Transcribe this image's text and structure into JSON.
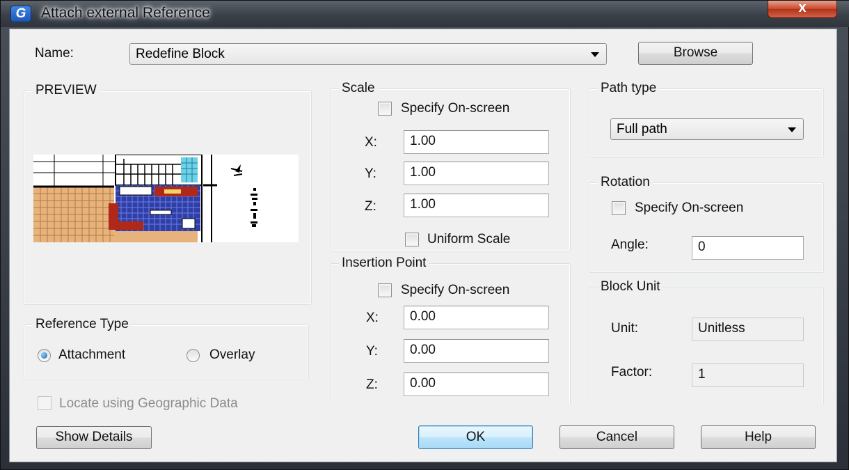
{
  "window": {
    "title": "Attach external Reference",
    "app_icon_glyph": "G",
    "close_glyph": "x"
  },
  "name_row": {
    "label": "Name:",
    "value": "Redefine Block",
    "browse_label": "Browse"
  },
  "preview": {
    "title": "PREVIEW"
  },
  "reference_type": {
    "title": "Reference Type",
    "options": [
      {
        "label": "Attachment",
        "selected": true
      },
      {
        "label": "Overlay",
        "selected": false
      }
    ]
  },
  "geo": {
    "label": "Locate using Geographic Data",
    "checked": false,
    "enabled": false
  },
  "scale": {
    "title": "Scale",
    "specify_label": "Specify On-screen",
    "x_label": "X:",
    "x": "1.00",
    "y_label": "Y:",
    "y": "1.00",
    "z_label": "Z:",
    "z": "1.00",
    "uniform_label": "Uniform Scale"
  },
  "insertion": {
    "title": "Insertion Point",
    "specify_label": "Specify On-screen",
    "x_label": "X:",
    "x": "0.00",
    "y_label": "Y:",
    "y": "0.00",
    "z_label": "Z:",
    "z": "0.00"
  },
  "path_type": {
    "title": "Path type",
    "value": "Full path"
  },
  "rotation": {
    "title": "Rotation",
    "specify_label": "Specify On-screen",
    "angle_label": "Angle:",
    "angle": "0"
  },
  "block_unit": {
    "title": "Block Unit",
    "unit_label": "Unit:",
    "unit": "Unitless",
    "factor_label": "Factor:",
    "factor": "1"
  },
  "buttons": {
    "show_details": "Show Details",
    "ok": "OK",
    "cancel": "Cancel",
    "help": "Help"
  },
  "colors": {
    "accent": "#3c7fb1",
    "close": "#c9472c",
    "panel": "#f0f0f0"
  }
}
